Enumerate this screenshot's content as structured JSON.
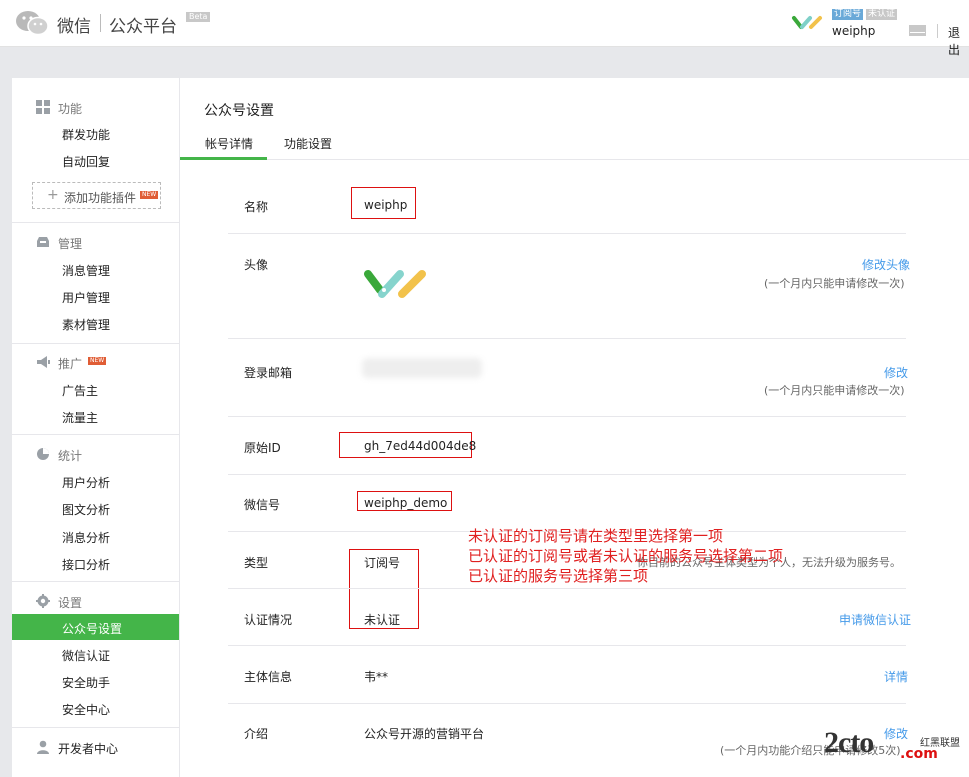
{
  "header": {
    "brand": "微信",
    "platform": "公众平台",
    "beta": "Beta",
    "account_tag": "订阅号",
    "account_status_tag": "未认证",
    "account_name": "weiphp",
    "logout": "退出"
  },
  "sidebar": {
    "sections": [
      {
        "title": "功能",
        "icon": "grid-icon",
        "items": [
          "群发功能",
          "自动回复"
        ]
      },
      {
        "title": "管理",
        "icon": "inbox-icon",
        "items": [
          "消息管理",
          "用户管理",
          "素材管理"
        ]
      },
      {
        "title": "推广",
        "icon": "megaphone-icon",
        "badge": "NEW",
        "items": [
          "广告主",
          "流量主"
        ]
      },
      {
        "title": "统计",
        "icon": "pie-chart-icon",
        "items": [
          "用户分析",
          "图文分析",
          "消息分析",
          "接口分析"
        ]
      },
      {
        "title": "设置",
        "icon": "gear-icon",
        "items": [
          "公众号设置",
          "微信认证",
          "安全助手",
          "安全中心"
        ]
      },
      {
        "title": "开发者中心",
        "icon": "user-icon",
        "items": []
      }
    ],
    "add_plugin": "添加功能插件",
    "add_plugin_badge": "NEW",
    "active_item": "公众号设置"
  },
  "main": {
    "title": "公众号设置",
    "tabs": [
      {
        "label": "帐号详情",
        "active": true
      },
      {
        "label": "功能设置",
        "active": false
      }
    ],
    "rows": {
      "name": {
        "label": "名称",
        "value": "weiphp"
      },
      "avatar": {
        "label": "头像",
        "link": "修改头像",
        "hint": "(一个月内只能申请修改一次)"
      },
      "email": {
        "label": "登录邮箱",
        "link": "修改",
        "hint": "(一个月内只能申请修改一次)"
      },
      "original_id": {
        "label": "原始ID",
        "value": "gh_7ed44d004de8"
      },
      "wechat_id": {
        "label": "微信号",
        "value": "weiphp_demo"
      },
      "type": {
        "label": "类型",
        "value": "订阅号",
        "hint": "你目前的公众号主体类型为个人，无法升级为服务号。"
      },
      "verification": {
        "label": "认证情况",
        "value": "未认证",
        "link": "申请微信认证"
      },
      "subject": {
        "label": "主体信息",
        "value": "韦**",
        "link": "详情"
      },
      "intro": {
        "label": "介绍",
        "value": "公众号开源的营销平台",
        "link": "修改",
        "hint": "(一个月内功能介绍只能申请修改5次)"
      }
    }
  },
  "annotation": {
    "lines": [
      "未认证的订阅号请在类型里选择第一项",
      "已认证的订阅号或者未认证的服务号选择第二项",
      "已认证的服务号选择第三项"
    ]
  },
  "watermark": {
    "main": "2cto",
    "suffix": ".com",
    "side": "红黑联盟"
  },
  "colors": {
    "accent": "#44b549",
    "link": "#459ae9",
    "annotation": "#e02020"
  }
}
